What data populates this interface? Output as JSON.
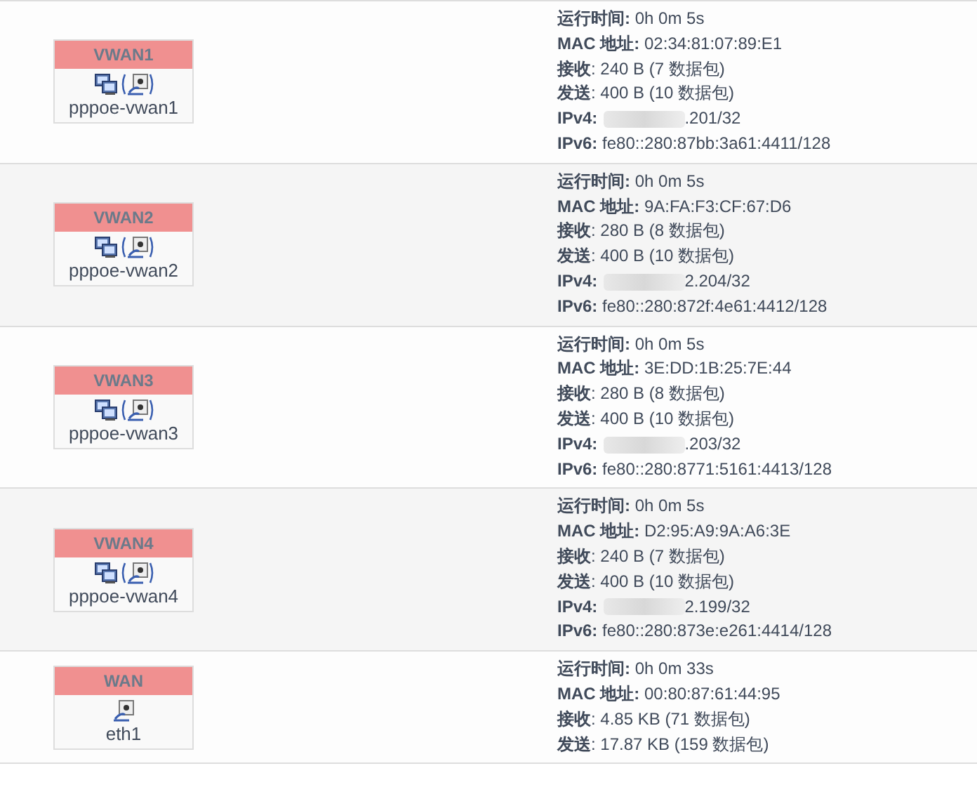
{
  "interfaces": [
    {
      "name": "VWAN1",
      "device": "pppoe-vwan1",
      "kind": "pppoe",
      "info": [
        "**运行时间:** 0h 0m 5s",
        "**MAC 地址:** 02:34:81:07:89:E1",
        "**接收**: 240 B (7 数据包)",
        "**发送**: 400 B (10 数据包)"
      ],
      "ipv4": {
        "label": "IPv4:",
        "value": ".201/32",
        "blurred": true
      },
      "ipv6": "**IPv6:** fe80::280:87bb:3a61:4411/128"
    },
    {
      "name": "VWAN2",
      "device": "pppoe-vwan2",
      "kind": "pppoe",
      "info": [
        "**运行时间:** 0h 0m 5s",
        "**MAC 地址:** 9A:FA:F3:CF:67:D6",
        "**接收**: 280 B (8 数据包)",
        "**发送**: 400 B (10 数据包)"
      ],
      "ipv4": {
        "label": "IPv4:",
        "value": "2.204/32",
        "blurred": true
      },
      "ipv6": "**IPv6:** fe80::280:872f:4e61:4412/128"
    },
    {
      "name": "VWAN3",
      "device": "pppoe-vwan3",
      "kind": "pppoe",
      "info": [
        "**运行时间:** 0h 0m 5s",
        "**MAC 地址:** 3E:DD:1B:25:7E:44",
        "**接收**: 280 B (8 数据包)",
        "**发送**: 400 B (10 数据包)"
      ],
      "ipv4": {
        "label": "IPv4:",
        "value": ".203/32",
        "blurred": true
      },
      "ipv6": "**IPv6:** fe80::280:8771:5161:4413/128"
    },
    {
      "name": "VWAN4",
      "device": "pppoe-vwan4",
      "kind": "pppoe",
      "info": [
        "**运行时间:** 0h 0m 5s",
        "**MAC 地址:** D2:95:A9:9A:A6:3E",
        "**接收**: 240 B (7 数据包)",
        "**发送**: 400 B (10 数据包)"
      ],
      "ipv4": {
        "label": "IPv4:",
        "value": "2.199/32",
        "blurred": true
      },
      "ipv6": "**IPv6:** fe80::280:873e:e261:4414/128"
    },
    {
      "name": "WAN",
      "device": "eth1",
      "kind": "ethernet",
      "info": [
        "**运行时间:** 0h 0m 33s",
        "**MAC 地址:** 00:80:87:61:44:95",
        "**接收**: 4.85 KB (71 数据包)",
        "**发送**: 17.87 KB (159 数据包)"
      ]
    }
  ]
}
